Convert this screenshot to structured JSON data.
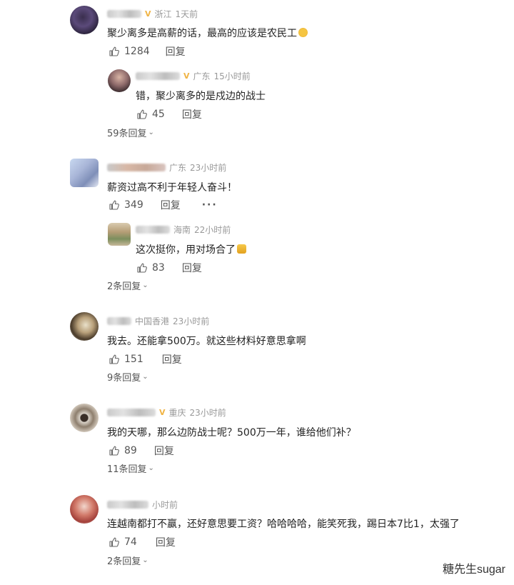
{
  "comments": [
    {
      "location": "浙江",
      "time": "1天前",
      "text": "聚少离多是高薪的话，最高的应该是农民工",
      "likes": "1284",
      "reply_label": "回复",
      "reply": {
        "location": "广东",
        "time": "15小时前",
        "text": "错，聚少离多的是戍边的战士",
        "likes": "45",
        "reply_label": "回复"
      },
      "reply_count": "59条回复"
    },
    {
      "location": "广东",
      "time": "23小时前",
      "text": "薪资过高不利于年轻人奋斗！",
      "likes": "349",
      "reply_label": "回复",
      "more": "···",
      "reply": {
        "location": "海南",
        "time": "22小时前",
        "text": "这次挺你，用对场合了",
        "likes": "83",
        "reply_label": "回复"
      },
      "reply_count": "2条回复"
    },
    {
      "location": "中国香港",
      "time": "23小时前",
      "text": "我去。还能拿500万。就这些材料好意思拿啊",
      "likes": "151",
      "reply_label": "回复",
      "reply_count": "9条回复"
    },
    {
      "location": "重庆",
      "time": "23小时前",
      "text": "我的天哪，那么边防战士呢？500万一年，谁给他们补？",
      "likes": "89",
      "reply_label": "回复",
      "reply_count": "11条回复"
    },
    {
      "time": "小时前",
      "text": "连越南都打不赢，还好意思要工资？哈哈哈哈，能笑死我，踢日本7比1，太强了",
      "likes": "74",
      "reply_label": "回复",
      "reply_count": "2条回复"
    }
  ],
  "watermark": "糖先生sugar",
  "icons": {
    "like": "thumb-up-icon",
    "expand": "chevron-down-icon"
  },
  "colors": {
    "meta": "#999999",
    "text": "#222222",
    "vip": "#f0b445"
  }
}
